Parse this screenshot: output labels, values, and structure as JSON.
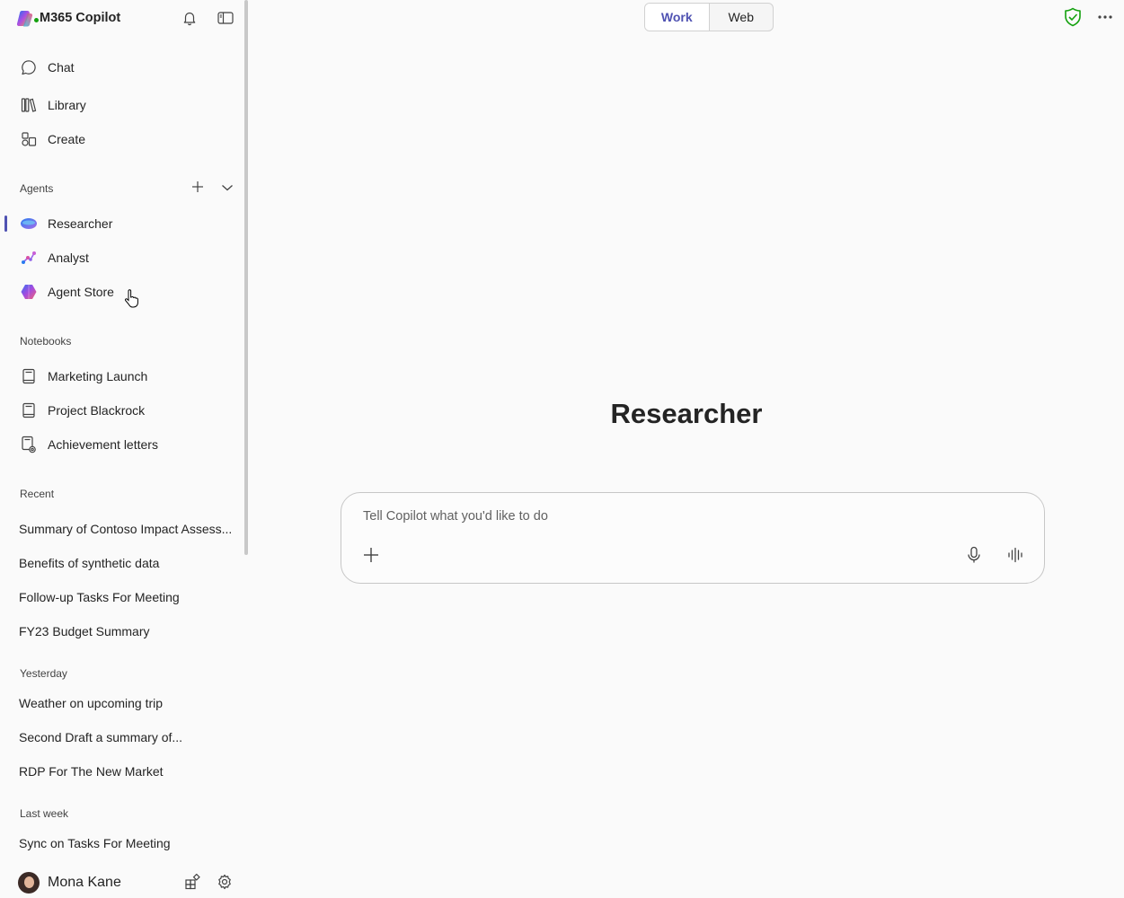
{
  "app": {
    "title": "M365 Copilot"
  },
  "nav": {
    "chat": "Chat",
    "library": "Library",
    "create": "Create"
  },
  "agents": {
    "label": "Agents",
    "items": [
      "Researcher",
      "Analyst",
      "Agent Store"
    ]
  },
  "notebooks": {
    "label": "Notebooks",
    "items": [
      "Marketing Launch",
      "Project Blackrock",
      "Achievement letters"
    ]
  },
  "recent": {
    "label": "Recent",
    "items": [
      "Summary of Contoso Impact Assess...",
      "Benefits of synthetic data",
      "Follow-up Tasks For Meeting",
      "FY23 Budget Summary"
    ]
  },
  "yesterday": {
    "label": "Yesterday",
    "items": [
      "Weather on upcoming trip",
      "Second Draft a summary of...",
      "RDP For The New Market"
    ]
  },
  "last_week": {
    "label": "Last week",
    "items": [
      "Sync on Tasks For Meeting"
    ]
  },
  "user": {
    "name": "Mona Kane"
  },
  "mode_toggle": {
    "work": "Work",
    "web": "Web",
    "selected": "Work"
  },
  "main": {
    "heading": "Researcher",
    "composer_placeholder": "Tell Copilot what you'd like to do"
  },
  "colors": {
    "accent": "#4f52b2",
    "shield": "#13a10e",
    "background": "#fafafa"
  }
}
